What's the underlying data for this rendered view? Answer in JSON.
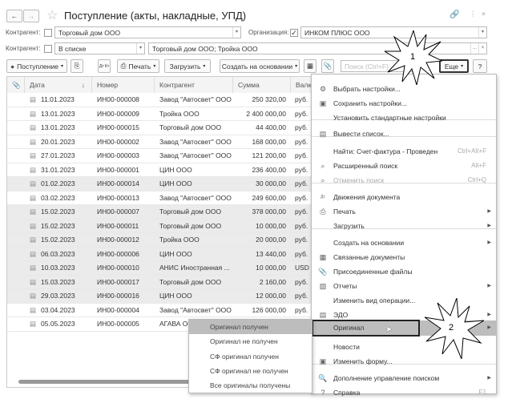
{
  "window": {
    "title": "Поступление (акты, накладные, УПД)"
  },
  "filters": {
    "contractor_label": "Контрагент:",
    "contractor_value": "Торговый дом ООО",
    "contractor_checked": false,
    "org_label": "Организация:",
    "org_value": "ИНКОМ ПЛЮС ООО",
    "org_checked": true,
    "contractor2_label": "Контрагент:",
    "contractor2_mode": "В списке",
    "contractor2_value": "Торговый дом ООО; Тройка ООО",
    "contractor2_checked": false,
    "dots": "...",
    "clear": "×"
  },
  "toolbar": {
    "receipt": "Поступление",
    "print": "Печать",
    "load": "Загрузить",
    "create_based": "Создать на основании",
    "search_placeholder": "Поиск (Ctrl+F)",
    "more": "Еще",
    "help": "?",
    "dtkt": "Дт Кт"
  },
  "table": {
    "headers": [
      "Дата",
      "Номер",
      "Контрагент",
      "Сумма",
      "Валют"
    ],
    "rows": [
      {
        "date": "11.01.2023",
        "num": "ИН00-000008",
        "contr": "Завод \"Автосвет\" ООО",
        "sum": "250 320,00",
        "cur": "руб."
      },
      {
        "date": "13.01.2023",
        "num": "ИН00-000009",
        "contr": "Тройка ООО",
        "sum": "2 400 000,00",
        "cur": "руб."
      },
      {
        "date": "13.01.2023",
        "num": "ИН00-000015",
        "contr": "Торговый дом ООО",
        "sum": "44 400,00",
        "cur": "руб."
      },
      {
        "date": "20.01.2023",
        "num": "ИН00-000002",
        "contr": "Завод \"Автосвет\" ООО",
        "sum": "168 000,00",
        "cur": "руб."
      },
      {
        "date": "27.01.2023",
        "num": "ИН00-000003",
        "contr": "Завод \"Автосвет\" ООО",
        "sum": "121 200,00",
        "cur": "руб."
      },
      {
        "date": "31.01.2023",
        "num": "ИН00-000001",
        "contr": "ЦИН ООО",
        "sum": "236 400,00",
        "cur": "руб."
      },
      {
        "date": "01.02.2023",
        "num": "ИН00-000014",
        "contr": "ЦИН ООО",
        "sum": "30 000,00",
        "cur": "руб."
      },
      {
        "date": "03.02.2023",
        "num": "ИН00-000013",
        "contr": "Завод \"Автосвет\" ООО",
        "sum": "249 600,00",
        "cur": "руб."
      },
      {
        "date": "15.02.2023",
        "num": "ИН00-000007",
        "contr": "Торговый дом ООО",
        "sum": "378 000,00",
        "cur": "руб."
      },
      {
        "date": "15.02.2023",
        "num": "ИН00-000011",
        "contr": "Торговый дом ООО",
        "sum": "10 000,00",
        "cur": "руб."
      },
      {
        "date": "15.02.2023",
        "num": "ИН00-000012",
        "contr": "Тройка ООО",
        "sum": "20 000,00",
        "cur": "руб."
      },
      {
        "date": "06.03.2023",
        "num": "ИН00-000006",
        "contr": "ЦИН ООО",
        "sum": "13 440,00",
        "cur": "руб."
      },
      {
        "date": "10.03.2023",
        "num": "ИН00-000010",
        "contr": "АНИС  Иностранная ...",
        "sum": "10 000,00",
        "cur": "USD"
      },
      {
        "date": "15.03.2023",
        "num": "ИН00-000017",
        "contr": "Торговый дом ООО",
        "sum": "2 160,00",
        "cur": "руб."
      },
      {
        "date": "29.03.2023",
        "num": "ИН00-000016",
        "contr": "ЦИН ООО",
        "sum": "12 000,00",
        "cur": "руб."
      },
      {
        "date": "03.04.2023",
        "num": "ИН00-000004",
        "contr": "Завод \"Автосвет\" ООО",
        "sum": "126 000,00",
        "cur": "руб."
      },
      {
        "date": "05.05.2023",
        "num": "ИН00-000005",
        "contr": "АГАВА  ООО",
        "sum": "",
        "cur": ""
      }
    ]
  },
  "menu": {
    "items": [
      {
        "label": "Выбрать настройки..."
      },
      {
        "label": "Сохранить настройки..."
      },
      {
        "label": "Установить стандартные настройки"
      },
      {
        "label": "Вывести список..."
      },
      {
        "label": "Найти: Счет-фактура - Проведен",
        "shortcut": "Ctrl+Alt+F"
      },
      {
        "label": "Расширенный поиск",
        "shortcut": "Alt+F"
      },
      {
        "label": "Отменить поиск",
        "shortcut": "Ctrl+Q"
      },
      {
        "label": "Движения документа"
      },
      {
        "label": "Печать"
      },
      {
        "label": "Загрузить"
      },
      {
        "label": "Создать на основании"
      },
      {
        "label": "Связанные документы"
      },
      {
        "label": "Присоединенные файлы"
      },
      {
        "label": "Отчеты"
      },
      {
        "label": "Изменить вид операции..."
      },
      {
        "label": "ЭДО"
      },
      {
        "label": "Оригинал"
      },
      {
        "label": "Новости"
      },
      {
        "label": "Изменить форму..."
      },
      {
        "label": "Дополнение управление поиском"
      },
      {
        "label": "Справка",
        "shortcut": "F1"
      }
    ]
  },
  "submenu": {
    "items": [
      "Оригинал получен",
      "Оригинал не получен",
      "СФ оригинал получен",
      "СФ оригинал не получен",
      "Все оригиналы получены"
    ]
  },
  "callouts": {
    "one": "1",
    "two": "2"
  }
}
